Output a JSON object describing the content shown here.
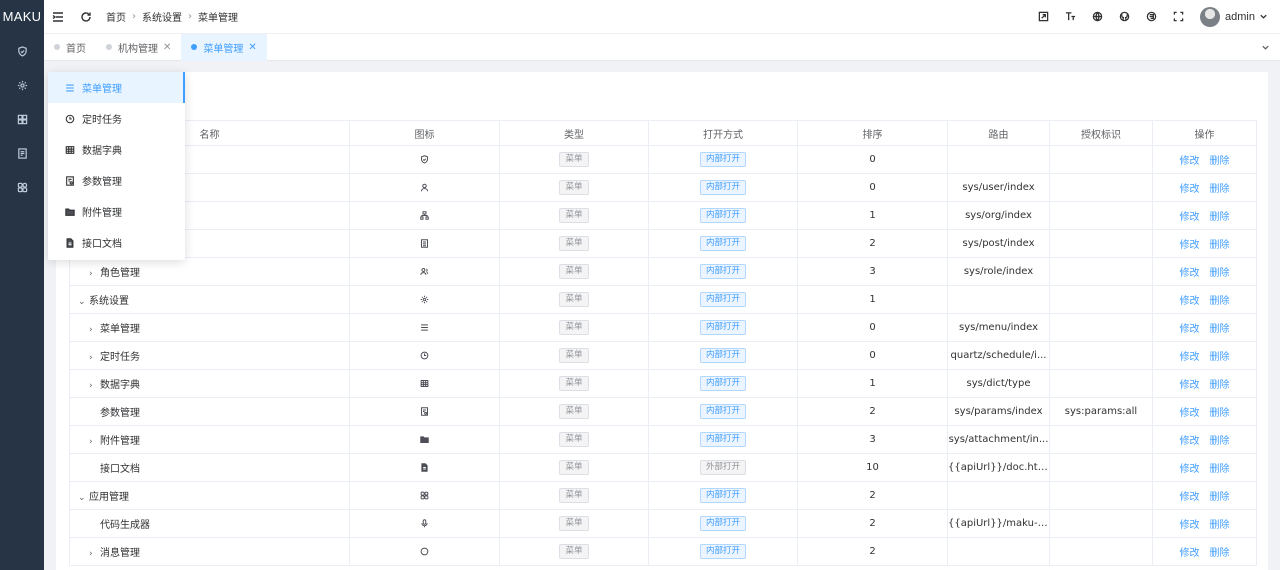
{
  "logo": "MAKU",
  "sidebar_icons": [
    "shield-icon",
    "gear-icon",
    "grid-icon",
    "doc-icon",
    "apps-icon"
  ],
  "breadcrumbs": [
    "首页",
    "系统设置",
    "菜单管理"
  ],
  "header": {
    "user": "admin"
  },
  "tabs": [
    {
      "label": "首页",
      "closable": false
    },
    {
      "label": "机构管理",
      "closable": true
    },
    {
      "label": "菜单管理",
      "closable": true,
      "active": true
    }
  ],
  "submenu": [
    {
      "label": "菜单管理",
      "icon": "list-icon",
      "active": true
    },
    {
      "label": "定时任务",
      "icon": "clock-icon"
    },
    {
      "label": "数据字典",
      "icon": "table-icon"
    },
    {
      "label": "参数管理",
      "icon": "params-icon"
    },
    {
      "label": "附件管理",
      "icon": "folder-icon"
    },
    {
      "label": "接口文档",
      "icon": "file-icon"
    }
  ],
  "table": {
    "headers": [
      "名称",
      "图标",
      "类型",
      "打开方式",
      "排序",
      "路由",
      "授权标识",
      "操作"
    ],
    "edit_label": "修改",
    "delete_label": "删除",
    "rows": [
      {
        "indent": 0,
        "arrow": "",
        "name": "",
        "icon": "shield-icon",
        "type": "菜单",
        "open": "内部打开",
        "open_blue": true,
        "sort": "0",
        "route": "",
        "auth": ""
      },
      {
        "indent": 0,
        "arrow": "",
        "name": "",
        "icon": "user-icon",
        "type": "菜单",
        "open": "内部打开",
        "open_blue": true,
        "sort": "0",
        "route": "sys/user/index",
        "auth": ""
      },
      {
        "indent": 0,
        "arrow": "",
        "name": "",
        "icon": "org-icon",
        "type": "菜单",
        "open": "内部打开",
        "open_blue": true,
        "sort": "1",
        "route": "sys/org/index",
        "auth": ""
      },
      {
        "indent": 0,
        "arrow": "",
        "name": "",
        "icon": "post-icon",
        "type": "菜单",
        "open": "内部打开",
        "open_blue": true,
        "sort": "2",
        "route": "sys/post/index",
        "auth": ""
      },
      {
        "indent": 1,
        "arrow": ">",
        "name": "角色管理",
        "icon": "role-icon",
        "type": "菜单",
        "open": "内部打开",
        "open_blue": true,
        "sort": "3",
        "route": "sys/role/index",
        "auth": ""
      },
      {
        "indent": 0,
        "arrow": "v",
        "name": "系统设置",
        "icon": "gear-icon",
        "type": "菜单",
        "open": "内部打开",
        "open_blue": true,
        "sort": "1",
        "route": "",
        "auth": ""
      },
      {
        "indent": 1,
        "arrow": ">",
        "name": "菜单管理",
        "icon": "list-icon",
        "type": "菜单",
        "open": "内部打开",
        "open_blue": true,
        "sort": "0",
        "route": "sys/menu/index",
        "auth": ""
      },
      {
        "indent": 1,
        "arrow": ">",
        "name": "定时任务",
        "icon": "clock-icon",
        "type": "菜单",
        "open": "内部打开",
        "open_blue": true,
        "sort": "0",
        "route": "quartz/schedule/i...",
        "auth": ""
      },
      {
        "indent": 1,
        "arrow": ">",
        "name": "数据字典",
        "icon": "table-icon",
        "type": "菜单",
        "open": "内部打开",
        "open_blue": true,
        "sort": "1",
        "route": "sys/dict/type",
        "auth": ""
      },
      {
        "indent": 1,
        "arrow": "",
        "name": "参数管理",
        "icon": "params-icon",
        "type": "菜单",
        "open": "内部打开",
        "open_blue": true,
        "sort": "2",
        "route": "sys/params/index",
        "auth": "sys:params:all"
      },
      {
        "indent": 1,
        "arrow": ">",
        "name": "附件管理",
        "icon": "folder-icon",
        "type": "菜单",
        "open": "内部打开",
        "open_blue": true,
        "sort": "3",
        "route": "sys/attachment/in...",
        "auth": ""
      },
      {
        "indent": 1,
        "arrow": "",
        "name": "接口文档",
        "icon": "file-icon",
        "type": "菜单",
        "open": "外部打开",
        "open_blue": false,
        "sort": "10",
        "route": "{{apiUrl}}/doc.html",
        "auth": ""
      },
      {
        "indent": 0,
        "arrow": "v",
        "name": "应用管理",
        "icon": "apps-icon",
        "type": "菜单",
        "open": "内部打开",
        "open_blue": true,
        "sort": "2",
        "route": "",
        "auth": ""
      },
      {
        "indent": 1,
        "arrow": "",
        "name": "代码生成器",
        "icon": "mic-icon",
        "type": "菜单",
        "open": "内部打开",
        "open_blue": true,
        "sort": "2",
        "route": "{{apiUrl}}/maku-g...",
        "auth": ""
      },
      {
        "indent": 1,
        "arrow": ">",
        "name": "消息管理",
        "icon": "msg-icon",
        "type": "菜单",
        "open": "内部打开",
        "open_blue": true,
        "sort": "2",
        "route": "",
        "auth": ""
      }
    ]
  }
}
